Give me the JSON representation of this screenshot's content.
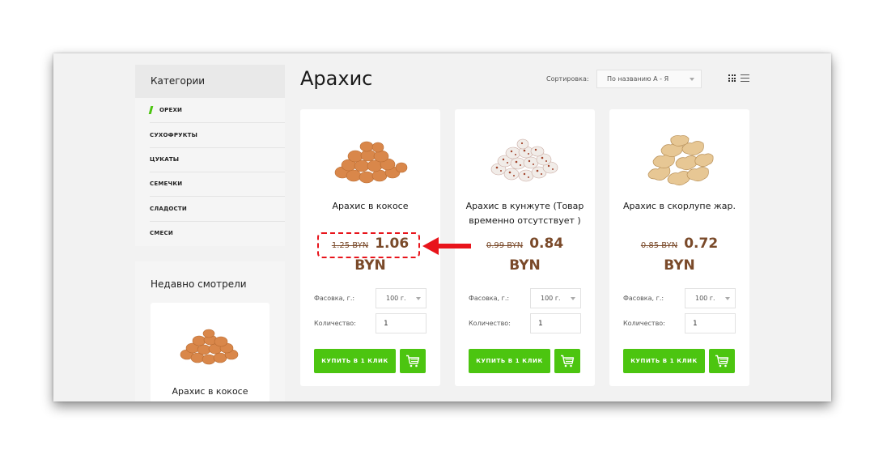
{
  "sidebar": {
    "categories_title": "Категории",
    "categories": [
      {
        "label": "Орехи",
        "active": true
      },
      {
        "label": "Сухофрукты"
      },
      {
        "label": "Цукаты"
      },
      {
        "label": "Семечки"
      },
      {
        "label": "Сладости"
      },
      {
        "label": "Смеси"
      }
    ],
    "recent_title": "Недавно смотрели",
    "recent_item": {
      "name": "Арахис в кокосе",
      "image": "nuts-in-coconut-image"
    }
  },
  "header": {
    "title": "Арахис",
    "sort_label": "Сортировка:",
    "sort_value": "По названию А - Я",
    "view_icons": [
      "grid-view-icon",
      "list-view-icon"
    ]
  },
  "products": [
    {
      "name": "Арахис в кокосе",
      "old_price": "1.25 BYN",
      "new_price": "1.06",
      "currency": "BYN",
      "pack_label": "Фасовка, г.:",
      "pack_value": "100 г.",
      "qty_label": "Количество:",
      "qty_value": "1",
      "buy_label": "КУПИТЬ В 1 КЛИК",
      "image": "peanuts-in-coconut-image"
    },
    {
      "name": "Арахис в кунжуте (Товар временно отсутствует )",
      "old_price": "0.99 BYN",
      "new_price": "0.84",
      "currency": "BYN",
      "pack_label": "Фасовка, г.:",
      "pack_value": "100 г.",
      "qty_label": "Количество:",
      "qty_value": "1",
      "buy_label": "КУПИТЬ В 1 КЛИК",
      "image": "peanuts-in-sesame-image"
    },
    {
      "name": "Арахис в скорлупе жар.",
      "old_price": "0.85 BYN",
      "new_price": "0.72",
      "currency": "BYN",
      "pack_label": "Фасовка, г.:",
      "pack_value": "100 г.",
      "qty_label": "Количество:",
      "qty_value": "1",
      "buy_label": "КУПИТЬ В 1 КЛИК",
      "image": "peanuts-in-shell-image"
    }
  ],
  "colors": {
    "accent_green": "#4cc510",
    "price_brown": "#7a4a2a",
    "annotation_red": "#e8141b"
  }
}
